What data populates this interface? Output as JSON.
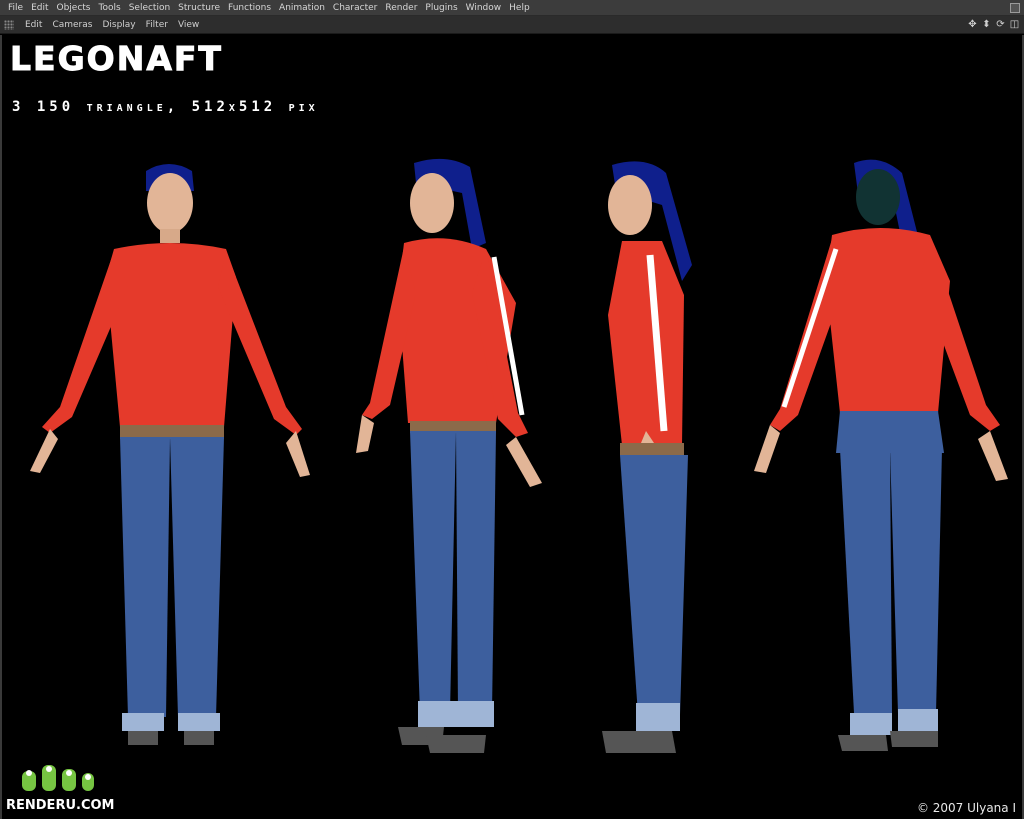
{
  "menubar": {
    "items": [
      "File",
      "Edit",
      "Objects",
      "Tools",
      "Selection",
      "Structure",
      "Functions",
      "Animation",
      "Character",
      "Render",
      "Plugins",
      "Window",
      "Help"
    ]
  },
  "viewport_toolbar": {
    "items": [
      "Edit",
      "Cameras",
      "Display",
      "Filter",
      "View"
    ],
    "nav_icons": [
      "move-view-icon",
      "zoom-view-icon",
      "rotate-view-icon",
      "maximize-view-icon"
    ]
  },
  "viewport": {
    "title": "LEGONAFT",
    "subtitle": "3 150 triangle, 512x512 pix",
    "views": [
      "front-view",
      "three-quarter-view",
      "side-view",
      "back-view"
    ],
    "colors": {
      "shirt": "#e53a2b",
      "jeans": "#3d5f9e",
      "hair": "#0f1f8c",
      "skin": "#e2b597",
      "background": "#000000"
    }
  },
  "watermark": {
    "logo_text": "RENDERU.COM",
    "copyright": "© 2007 Ulyana I"
  }
}
